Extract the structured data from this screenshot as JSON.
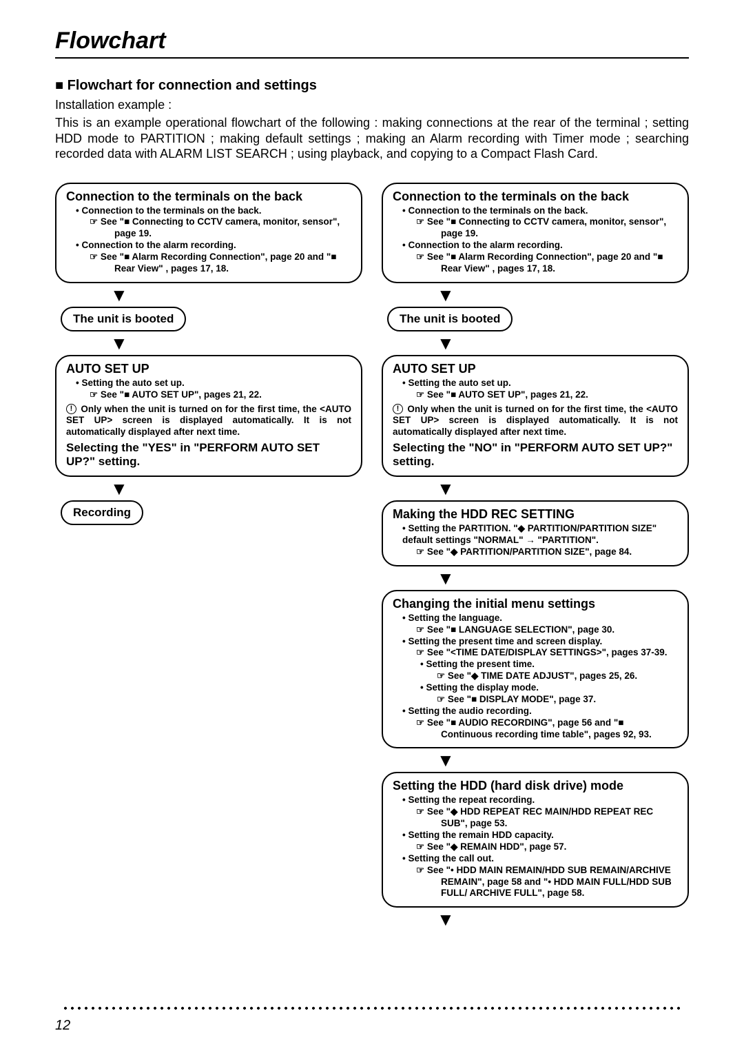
{
  "page_title": "Flowchart",
  "section_heading": "Flowchart for connection and settings",
  "intro_sub": "Installation example :",
  "intro_para": "This is an example operational flowchart of the following : making connections at the rear of the terminal ; setting HDD mode to PARTITION ; making default settings ; making an Alarm recording with Timer mode ; searching recorded data with ALARM LIST SEARCH ; using playback, and copying to a Compact Flash Card.",
  "page_number": "12",
  "left": {
    "box1": {
      "title": "Connection to the terminals on the back",
      "b1": "Connection to the terminals on the back.",
      "r1": "See \"■ Connecting to CCTV camera, monitor, sensor\", page 19.",
      "b2": "Connection to the alarm recording.",
      "r2": "See \"■ Alarm Recording Connection\", page 20 and \"■ Rear View\" , pages 17, 18."
    },
    "pill1": "The unit is booted",
    "box2": {
      "title": "AUTO SET UP",
      "b1": "Setting the auto set up.",
      "r1": "See \"■ AUTO SET UP\", pages 21, 22.",
      "note": "Only when the unit is turned on for the first time, the <AUTO SET UP> screen is displayed automatically. It is not automatically displayed after next time.",
      "subhead": "Selecting the \"YES\" in \"PERFORM AUTO SET UP?\" setting."
    },
    "pill2": "Recording"
  },
  "right": {
    "box1": {
      "title": "Connection to the terminals on the back",
      "b1": "Connection to the terminals on the back.",
      "r1": "See \"■ Connecting to CCTV camera, monitor, sensor\", page 19.",
      "b2": "Connection to the alarm recording.",
      "r2": "See \"■ Alarm Recording Connection\", page 20 and \"■ Rear View\" , pages 17, 18."
    },
    "pill1": "The unit is booted",
    "box2": {
      "title": "AUTO SET UP",
      "b1": "Setting the auto set up.",
      "r1": "See \"■ AUTO SET UP\", pages 21, 22.",
      "note": "Only when the unit is turned on for the first time, the <AUTO SET UP> screen is displayed automatically. It is not automatically displayed after next time.",
      "subhead": "Selecting the \"NO\" in \"PERFORM AUTO SET UP?\" setting."
    },
    "box3": {
      "title": "Making the HDD REC SETTING",
      "b1": "Setting the PARTITION.  \"◆ PARTITION/PARTITION SIZE\" default settings \"NORMAL\" → \"PARTITION\".",
      "r1": "See \"◆ PARTITION/PARTITION SIZE\", page 84."
    },
    "box4": {
      "title": "Changing the initial menu settings",
      "b1": "Setting the language.",
      "r1": "See \"■ LANGUAGE SELECTION\", page 30.",
      "b2": "Setting the present time and screen display.",
      "r2": "See \"<TIME DATE/DISPLAY SETTINGS>\", pages 37-39.",
      "nb1": "Setting the present time.",
      "nr1": "See \"◆ TIME DATE ADJUST\", pages 25, 26.",
      "nb2": "Setting the display mode.",
      "nr2": "See \"■ DISPLAY MODE\", page 37.",
      "b3": "Setting the audio recording.",
      "r3": "See \"■ AUDIO RECORDING\", page 56 and \"■ Continuous recording time table\", pages 92, 93."
    },
    "box5": {
      "title": "Setting the HDD (hard disk drive) mode",
      "b1": "Setting the repeat recording.",
      "r1": "See \"◆ HDD REPEAT REC MAIN/HDD REPEAT REC SUB\", page 53.",
      "b2": "Setting the remain HDD capacity.",
      "r2": "See \"◆ REMAIN HDD\", page 57.",
      "b3": "Setting the call out.",
      "r3": "See \"• HDD MAIN REMAIN/HDD SUB REMAIN/ARCHIVE REMAIN\", page 58 and \"• HDD MAIN FULL/HDD SUB FULL/ ARCHIVE FULL\", page 58."
    }
  }
}
